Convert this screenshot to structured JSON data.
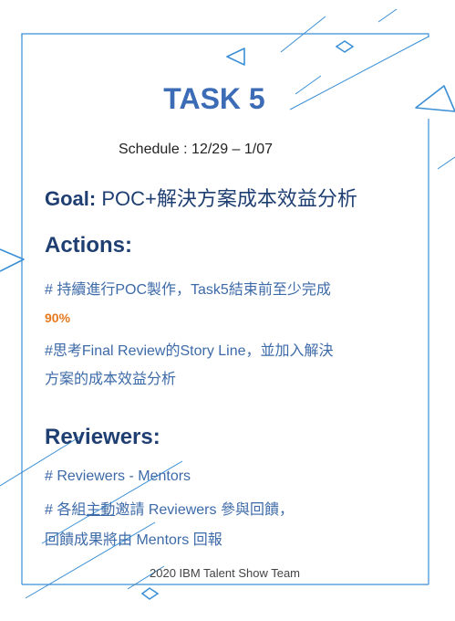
{
  "title": "TASK 5",
  "schedule": "Schedule : 12/29 – 1/07",
  "goal": {
    "label": "Goal:",
    "text": " POC+解決方案成本效益分析"
  },
  "actions": {
    "heading": "Actions:",
    "line1": "# 持續進行POC製作，Task5結束前至少完成",
    "highlight": "90%",
    "line2": "#思考Final Review的Story Line，並加入解決",
    "line3": "方案的成本效益分析"
  },
  "reviewers": {
    "heading": "Reviewers:",
    "line1": "# Reviewers - Mentors",
    "line2_prefix": "# 各組",
    "line2_underlined": "主動",
    "line2_suffix": "邀請 Reviewers 參與回饋，",
    "line3": "回饋成果將由 Mentors 回報"
  },
  "footer": "2020 IBM Talent Show Team",
  "colors": {
    "title": "#3b6cb5",
    "heading": "#1f3f73",
    "body": "#3d6aa8",
    "highlight": "#e7791f",
    "frame": "#3a8fd6"
  }
}
